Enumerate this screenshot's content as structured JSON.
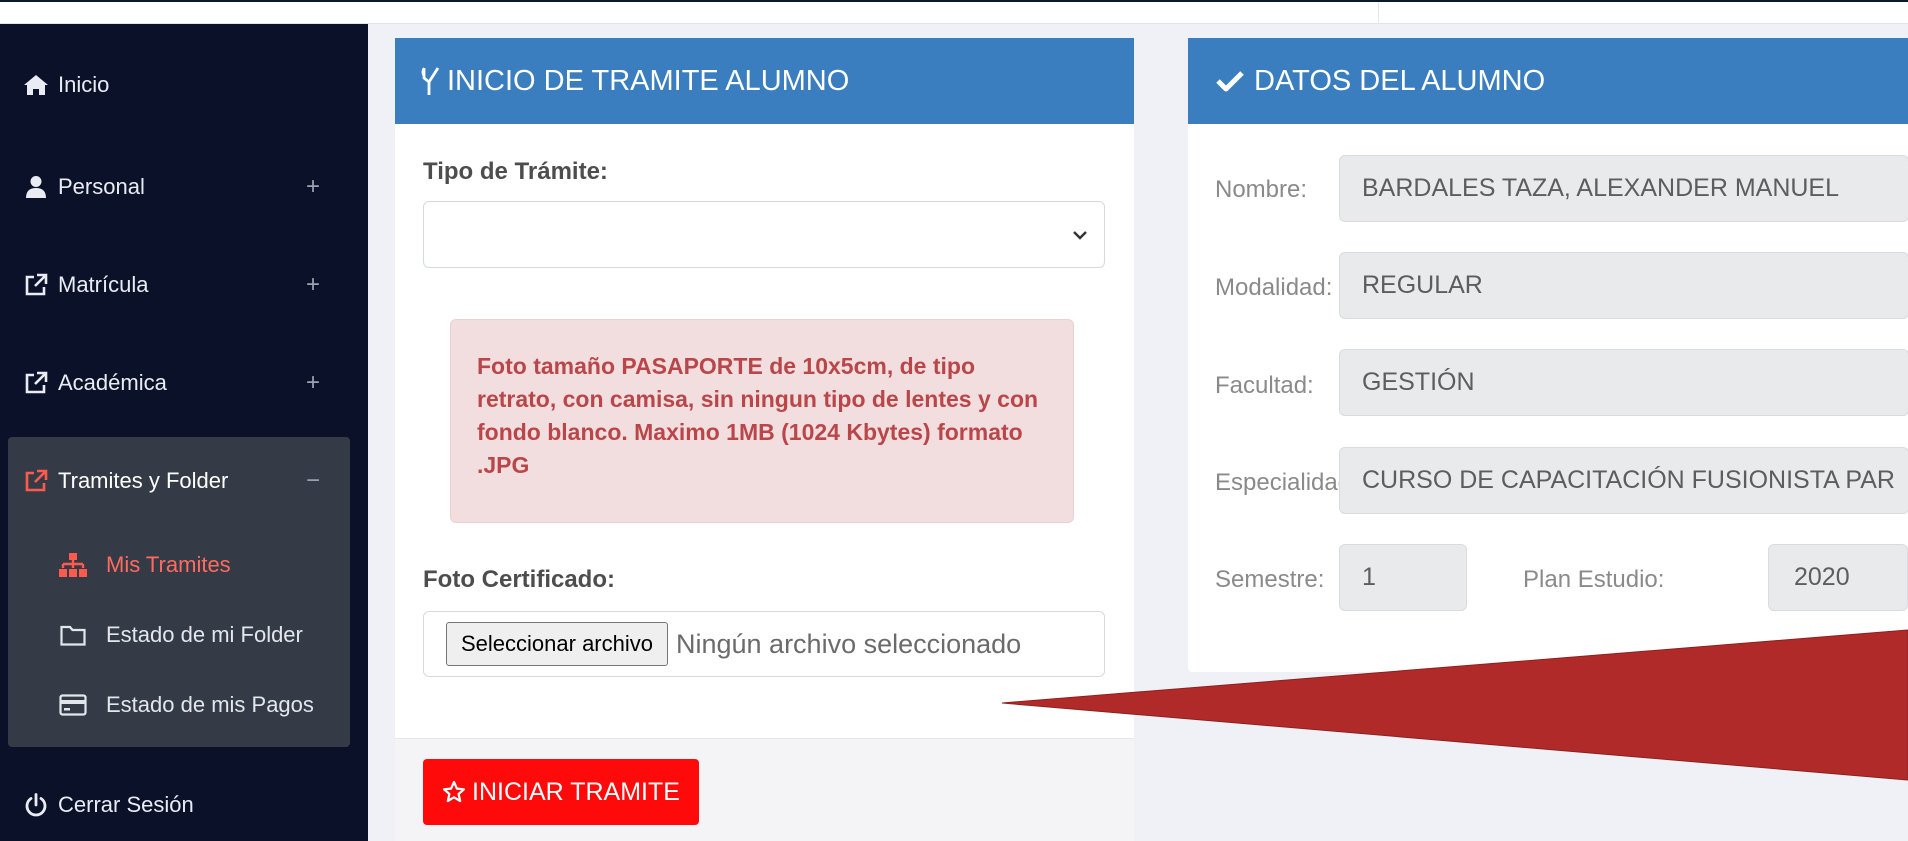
{
  "sidebar": {
    "items": [
      {
        "label": "Inicio",
        "icon": "home-icon"
      },
      {
        "label": "Personal",
        "icon": "user-icon",
        "expander": "+"
      },
      {
        "label": "Matrícula",
        "icon": "external-link-icon",
        "expander": "+"
      },
      {
        "label": "Académica",
        "icon": "external-link-icon",
        "expander": "+"
      },
      {
        "label": "Tramites y Folder",
        "icon": "external-link-icon",
        "expander": "−",
        "children": [
          {
            "label": "Mis Tramites",
            "icon": "sitemap-icon",
            "active": true
          },
          {
            "label": "Estado de mi Folder",
            "icon": "folder-icon"
          },
          {
            "label": "Estado de mis Pagos",
            "icon": "credit-card-icon"
          }
        ]
      },
      {
        "label": "Cerrar Sesión",
        "icon": "power-icon"
      }
    ]
  },
  "tramite": {
    "title": "INICIO DE TRAMITE ALUMNO",
    "tipo_label": "Tipo de Trámite:",
    "tipo_value": "",
    "alert_text": "Foto tamaño PASAPORTE de 10x5cm, de tipo retrato, con camisa, sin ningun tipo de lentes y con fondo blanco. Maximo 1MB (1024 Kbytes) formato .JPG",
    "foto_label": "Foto Certificado:",
    "file_button": "Seleccionar archivo",
    "file_status": "Ningún archivo seleccionado",
    "submit_label": "INICIAR TRAMITE"
  },
  "alumno": {
    "title": "DATOS DEL ALUMNO",
    "nombre_label": "Nombre:",
    "nombre": "BARDALES TAZA, ALEXANDER MANUEL",
    "modalidad_label": "Modalidad:",
    "modalidad": "REGULAR",
    "facultad_label": "Facultad:",
    "facultad": "GESTIÓN",
    "especialidad_label": "Especialidad:",
    "especialidad": "CURSO DE CAPACITACIÓN FUSIONISTA PAR",
    "semestre_label": "Semestre:",
    "semestre": "1",
    "plan_label": "Plan Estudio:",
    "plan": "2020"
  },
  "colors": {
    "sidebar_bg": "#0a1128",
    "header_blue": "#3a7ebf",
    "alert_bg": "#f3dedf",
    "alert_text": "#b9474a",
    "submit_red": "#ff0a0a",
    "active_link": "#ff6b5e",
    "annotation_arrow": "#b02a2a"
  }
}
